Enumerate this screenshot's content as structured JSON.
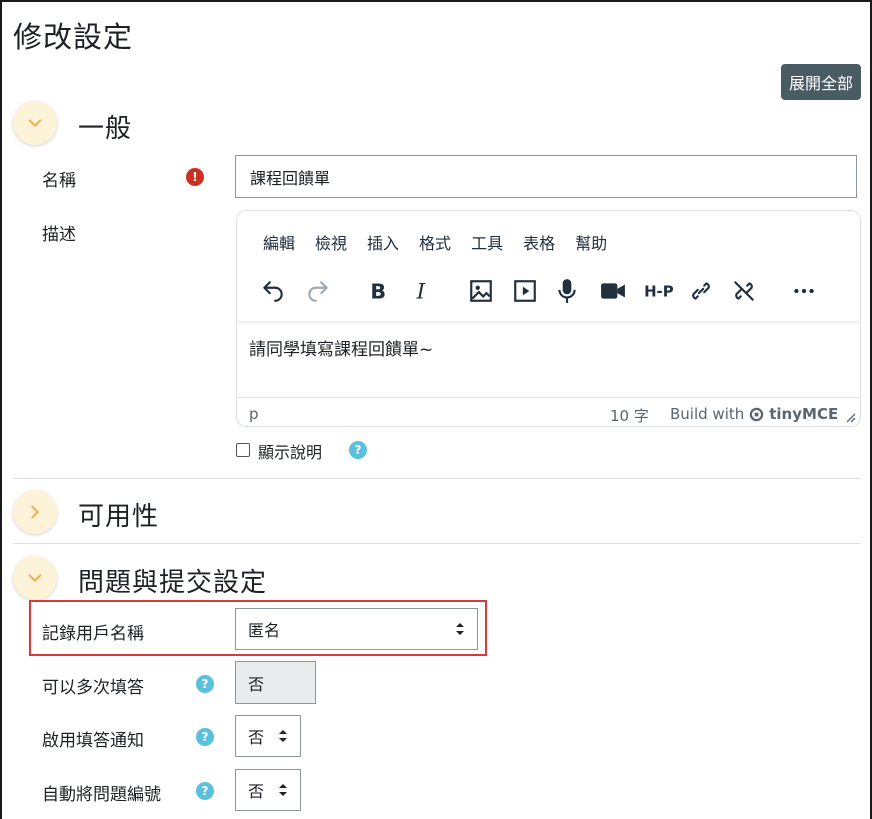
{
  "page": {
    "title": "修改設定",
    "expand_all_label": "展開全部"
  },
  "sections": {
    "general": {
      "title": "一般"
    },
    "availability": {
      "title": "可用性"
    },
    "questions": {
      "title": "問題與提交設定"
    }
  },
  "fields": {
    "name": {
      "label": "名稱",
      "value": "課程回饋單"
    },
    "description": {
      "label": "描述"
    },
    "show_description": {
      "label": "顯示說明"
    },
    "record_user": {
      "label": "記錄用戶名稱",
      "value": "匿名"
    },
    "multiple": {
      "label": "可以多次填答",
      "value": "否"
    },
    "notify": {
      "label": "啟用填答通知",
      "value": "否"
    },
    "autonumber": {
      "label": "自動將問題編號",
      "value": "否"
    }
  },
  "editor": {
    "menu": [
      "編輯",
      "檢視",
      "插入",
      "格式",
      "工具",
      "表格",
      "幫助"
    ],
    "content": "請同學填寫課程回饋單~",
    "status_path": "p",
    "word_count": "10 字",
    "build_with": "Build with",
    "brand": "tinyMCE"
  },
  "colors": {
    "expand_button": "#495b63",
    "toggle_bg": "#fdf3d8",
    "chevron": "#f0ad4e",
    "help": "#5bc0de",
    "required": "#ca3120",
    "highlight": "#d63a3a"
  }
}
